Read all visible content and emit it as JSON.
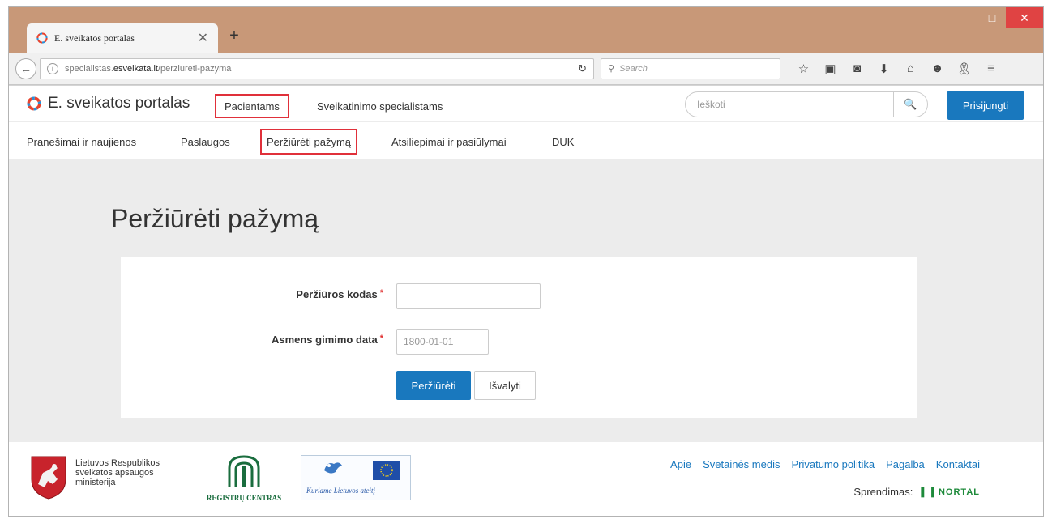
{
  "browser": {
    "tab_title": "E. sveikatos portalas",
    "new_tab_label": "+",
    "url_prefix": "specialistas.",
    "url_domain": "esveikata.lt",
    "url_path": "/perziureti-pazyma",
    "search_placeholder": "Search",
    "window_controls": {
      "minimize": "–",
      "maximize": "□",
      "close": "✕"
    }
  },
  "site": {
    "logo_text": "E. sveikatos portalas",
    "nav": {
      "patients": "Pacientams",
      "specialists": "Sveikatinimo specialistams"
    },
    "search_placeholder": "Ieškoti",
    "login_label": "Prisijungti",
    "subnav": [
      "Pranešimai ir naujienos",
      "Paslaugos",
      "Peržiūrėti pažymą",
      "Atsiliepimai ir pasiūlymai",
      "DUK"
    ]
  },
  "main": {
    "title": "Peržiūrėti pažymą",
    "form": {
      "code_label": "Peržiūros kodas",
      "code_value": "",
      "birth_label": "Asmens gimimo data",
      "birth_placeholder": "1800-01-01",
      "required_mark": "*",
      "submit_label": "Peržiūrėti",
      "clear_label": "Išvalyti"
    }
  },
  "footer": {
    "ministry_lines": [
      "Lietuvos Respublikos",
      "sveikatos apsaugos",
      "ministerija"
    ],
    "registru_label": "REGISTRŲ CENTRAS",
    "eu_slogan": "Kuriame Lietuvos ateitį",
    "links": [
      "Apie",
      "Svetainės medis",
      "Privatumo politika",
      "Pagalba",
      "Kontaktai"
    ],
    "credit_label": "Sprendimas:",
    "credit_brand": "NORTAL"
  },
  "colors": {
    "primary": "#1978be",
    "highlight_border": "#e0303a",
    "titlebar": "#c89878",
    "close_button": "#e04343"
  }
}
